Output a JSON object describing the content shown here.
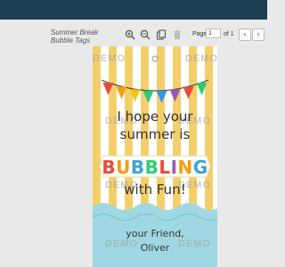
{
  "document": {
    "title": "Summer Break Bubble Tags"
  },
  "toolbar": {
    "zoom_in_icon": "zoom-in-icon",
    "zoom_out_icon": "zoom-out-icon",
    "copy_icon": "copy-icon",
    "delete_icon": "trash-icon",
    "page_label": "Page",
    "page_value": "1",
    "page_of": "of 1",
    "prev_symbol": "‹",
    "next_symbol": "›"
  },
  "tag": {
    "watermark": "DEMO",
    "line1": "I hope your",
    "line2": "summer is",
    "headline": "BUBBLING",
    "line3": "with Fun!",
    "signoff": "your Friend,",
    "name": "Oliver"
  },
  "colors": {
    "header_bar": "#1d3d52",
    "stripe_yellow": "#f3cf6a",
    "water_blue": "#9fd8e2",
    "bunting": [
      "#e84b3c",
      "#f39c12",
      "#f1c40f",
      "#2ecc71",
      "#3498db",
      "#9b59b6",
      "#e84b3c",
      "#2ecc71"
    ],
    "headline_letters": [
      "#e84b3c",
      "#f39c12",
      "#3aa3d9",
      "#2ecc71",
      "#e84b3c",
      "#9b59b6",
      "#f39c12",
      "#3aa3d9"
    ]
  }
}
